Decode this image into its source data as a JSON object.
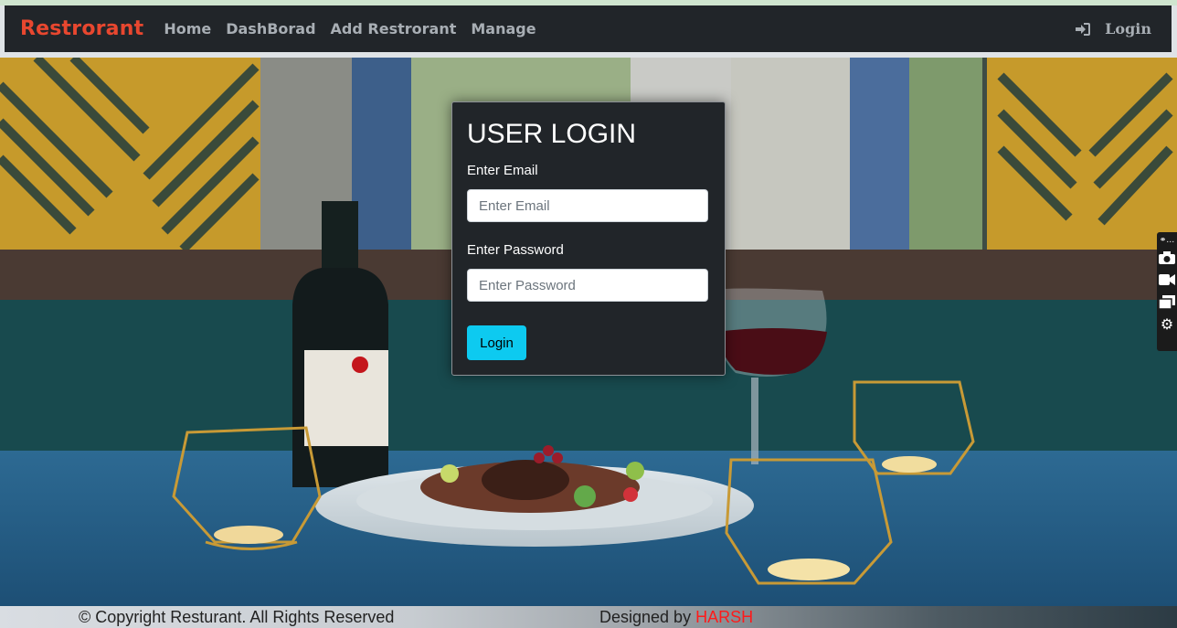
{
  "navbar": {
    "brand": "Restrorant",
    "links": [
      "Home",
      "DashBorad",
      "Add Restrorant",
      "Manage"
    ],
    "login_label": "Login",
    "login_icon": "sign-in-icon"
  },
  "login_card": {
    "title": "USER LOGIN",
    "email_label": "Enter Email",
    "email_placeholder": "Enter Email",
    "email_value": "",
    "password_label": "Enter Password",
    "password_placeholder": "Enter Password",
    "password_value": "",
    "submit_label": "Login"
  },
  "side_toolbar": {
    "icons": [
      "link-icon",
      "camera-icon",
      "video-icon",
      "window-icon",
      "gear-icon"
    ]
  },
  "footer": {
    "copyright": "© Copyright Resturant. All Rights Reserved",
    "designed_prefix": "Designed by ",
    "designer": "HARSH"
  },
  "colors": {
    "brand": "#e8472f",
    "navbar_bg": "#212529",
    "accent_button": "#0dcaf0",
    "designer_text": "#ff1a1a"
  }
}
